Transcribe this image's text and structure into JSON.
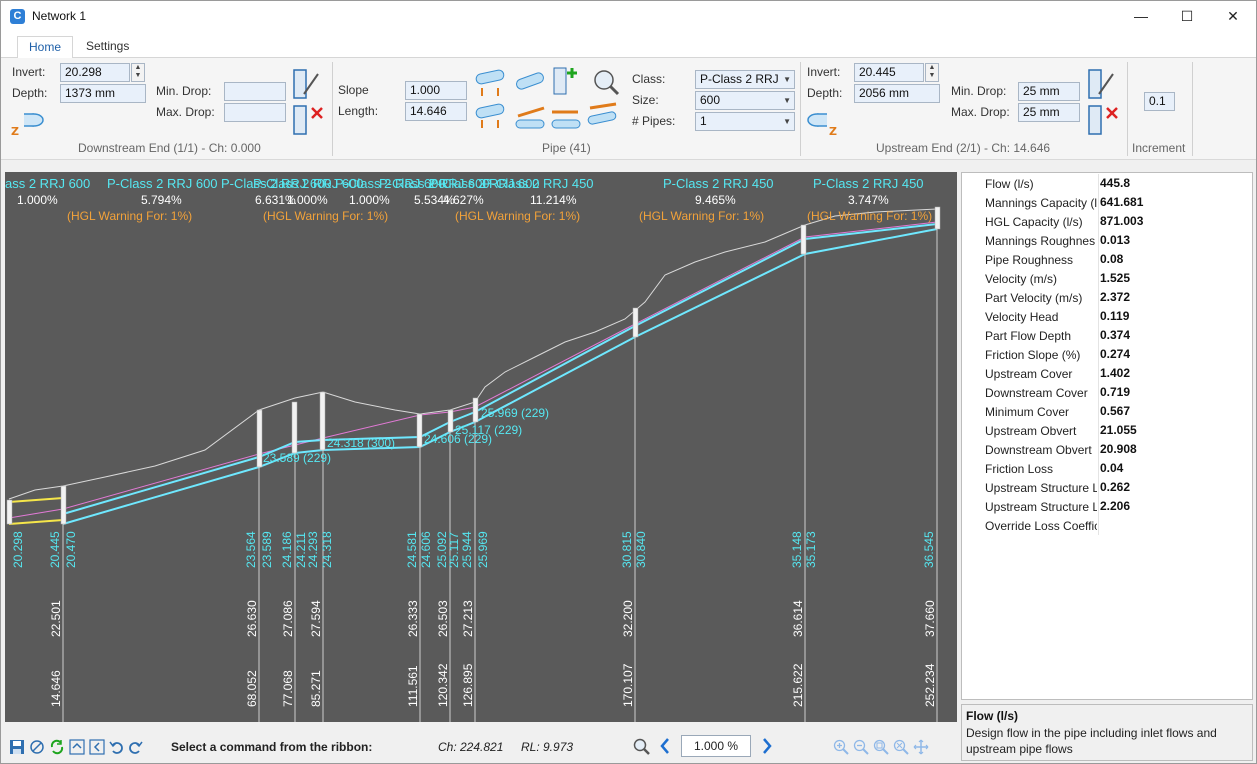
{
  "window": {
    "title": "Network 1",
    "minimize_glyph": "—",
    "maximize_glyph": "☐",
    "close_glyph": "✕"
  },
  "tabs": [
    {
      "label": "Home"
    },
    {
      "label": "Settings"
    }
  ],
  "ribbon": {
    "downstream": {
      "invert_label": "Invert:",
      "invert_value": "20.298",
      "depth_label": "Depth:",
      "depth_value": "1373 mm",
      "min_drop_label": "Min. Drop:",
      "min_drop_value": "",
      "max_drop_label": "Max. Drop:",
      "max_drop_value": "",
      "group_label": "Downstream End (1/1) - Ch: 0.000"
    },
    "pipe": {
      "slope_label": "Slope",
      "slope_value": "1.000",
      "length_label": "Length:",
      "length_value": "14.646",
      "class_label": "Class:",
      "class_value": "P-Class 2 RRJ",
      "size_label": "Size:",
      "size_value": "600",
      "pipes_label": "# Pipes:",
      "pipes_value": "1",
      "group_label": "Pipe (41)"
    },
    "upstream": {
      "invert_label": "Invert:",
      "invert_value": "20.445",
      "depth_label": "Depth:",
      "depth_value": "2056 mm",
      "min_drop_label": "Min. Drop:",
      "min_drop_value": "25 mm",
      "max_drop_label": "Max. Drop:",
      "max_drop_value": "25 mm",
      "group_label": "Upstream End (2/1) - Ch: 14.646"
    },
    "increment": {
      "value": "0.1",
      "group_label": "Increment"
    }
  },
  "profile": {
    "pipe_labels": [
      {
        "name": "ass 2 RRJ 600",
        "slope": "1.000%",
        "warning": ""
      },
      {
        "name": "P-Class 2 RRJ 600",
        "slope": "5.794%",
        "warning": "(HGL Warning For: 1%)"
      },
      {
        "name": "P-Class 2 RRJ 600",
        "slope": "6.631%",
        "warning": ""
      },
      {
        "name": "P-Class 2 RRJ 600",
        "slope": "1.000%",
        "warning": "(HGL Warning For: 1%)"
      },
      {
        "name": "P-Class 2 RRJ 600",
        "slope": "1.000%",
        "warning": ""
      },
      {
        "name": "P-Class 2 RRJ 600",
        "slope": "5.534%",
        "warning": ""
      },
      {
        "name": "P-Class 2 RRJ 600",
        "slope": "4.627%",
        "warning": ""
      },
      {
        "name": "P-Class 2 RRJ 450",
        "slope": "11.214%",
        "warning": "(HGL Warning For: 1%)"
      },
      {
        "name": "P-Class 2 RRJ 450",
        "slope": "9.465%",
        "warning": "(HGL Warning For: 1%)"
      },
      {
        "name": "P-Class 2 RRJ 450",
        "slope": "3.747%",
        "warning": "(HGL Warning For: 1%)"
      }
    ],
    "structure_labels": [
      {
        "text": "23.589 (229)"
      },
      {
        "text": "24.318 (300)"
      },
      {
        "text": "24.606 (229)"
      },
      {
        "text": "25.117 (229)"
      },
      {
        "text": "25.969 (229)"
      }
    ],
    "invert_columns": [
      [
        "20.298"
      ],
      [
        "20.445"
      ],
      [
        "20.470"
      ],
      [
        "23.564"
      ],
      [
        "23.589"
      ],
      [
        "24.186"
      ],
      [
        "24.211"
      ],
      [
        "24.293"
      ],
      [
        "24.318"
      ],
      [
        "24.581"
      ],
      [
        "24.606"
      ],
      [
        "25.092"
      ],
      [
        "25.117"
      ],
      [
        "25.944"
      ],
      [
        "25.969"
      ],
      [
        "30.815"
      ],
      [
        "30.840"
      ],
      [
        "35.148"
      ],
      [
        "35.173"
      ],
      [
        "36.545"
      ]
    ],
    "surface_levels": [
      "22.501",
      "26.630",
      "27.086",
      "27.594",
      "26.333",
      "26.503",
      "27.213",
      "32.200",
      "36.614",
      "37.660"
    ],
    "chainages": [
      "14.646",
      "68.052",
      "77.068",
      "85.271",
      "111.561",
      "120.342",
      "126.895",
      "170.107",
      "215.622",
      "252.234"
    ]
  },
  "properties": [
    {
      "name": "Flow (l/s)",
      "value": "445.8"
    },
    {
      "name": "Mannings Capacity (l",
      "value": "641.681"
    },
    {
      "name": "HGL Capacity (l/s)",
      "value": "871.003"
    },
    {
      "name": "Mannings Roughnes",
      "value": "0.013"
    },
    {
      "name": "Pipe Roughness",
      "value": "0.08"
    },
    {
      "name": "Velocity (m/s)",
      "value": "1.525"
    },
    {
      "name": "Part Velocity (m/s)",
      "value": "2.372"
    },
    {
      "name": "Velocity Head",
      "value": "0.119"
    },
    {
      "name": "Part Flow Depth",
      "value": "0.374"
    },
    {
      "name": "Friction Slope (%)",
      "value": "0.274"
    },
    {
      "name": "Upstream Cover",
      "value": "1.402"
    },
    {
      "name": "Downstream Cover",
      "value": "0.719"
    },
    {
      "name": "Minimum Cover",
      "value": "0.567"
    },
    {
      "name": "Upstream Obvert",
      "value": "21.055"
    },
    {
      "name": "Downstream Obvert",
      "value": "20.908"
    },
    {
      "name": "Friction Loss",
      "value": "0.04"
    },
    {
      "name": "Upstream Structure L",
      "value": "0.262"
    },
    {
      "name": "Upstream Structure L",
      "value": "2.206"
    },
    {
      "name": "Override Loss Coeffic",
      "value": ""
    }
  ],
  "description": {
    "title": "Flow (l/s)",
    "text": "Design flow in the pipe including inlet flows and upstream pipe flows"
  },
  "status": {
    "message": "Select a command from the ribbon:",
    "chainage": "Ch: 224.821",
    "rl": "RL: 9.973",
    "zoom": "1.000 %"
  },
  "colors": {
    "profile_bg": "#5a5a5a",
    "label_cyan": "#55e8f2",
    "warning_orange": "#f2a23a",
    "pipe_cyan": "#6fe8ff",
    "hgl_pink": "#e27ad6",
    "surface_white": "#d9d9d9",
    "selected_yellow": "#f5e64a"
  }
}
